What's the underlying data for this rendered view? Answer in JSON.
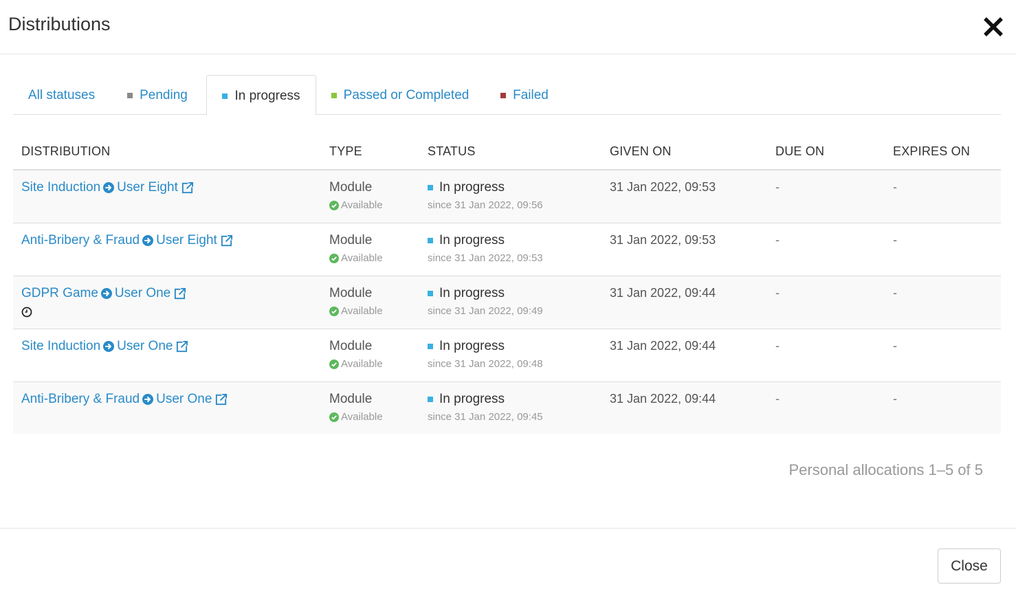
{
  "header": {
    "title": "Distributions"
  },
  "tabs": [
    {
      "label": "All statuses",
      "square_color": null
    },
    {
      "label": "Pending",
      "square_color": "#8a8a8a"
    },
    {
      "label": "In progress",
      "square_color": "#3ab0e2"
    },
    {
      "label": "Passed or Completed",
      "square_color": "#8cc63f"
    },
    {
      "label": "Failed",
      "square_color": "#a33b3b"
    }
  ],
  "active_tab": "In progress",
  "table": {
    "columns": [
      "DISTRIBUTION",
      "TYPE",
      "STATUS",
      "GIVEN ON",
      "DUE ON",
      "EXPIRES ON"
    ],
    "rows": [
      {
        "course": "Site Induction",
        "user": "User Eight",
        "has_clock": false,
        "type": "Module",
        "availability": "Available",
        "status": "In progress",
        "since": "since 31 Jan 2022, 09:56",
        "given_on": "31 Jan 2022, 09:53",
        "due_on": "-",
        "expires_on": "-"
      },
      {
        "course": "Anti-Bribery & Fraud",
        "user": "User Eight",
        "has_clock": false,
        "type": "Module",
        "availability": "Available",
        "status": "In progress",
        "since": "since 31 Jan 2022, 09:53",
        "given_on": "31 Jan 2022, 09:53",
        "due_on": "-",
        "expires_on": "-"
      },
      {
        "course": "GDPR Game",
        "user": "User One",
        "has_clock": true,
        "type": "Module",
        "availability": "Available",
        "status": "In progress",
        "since": "since 31 Jan 2022, 09:49",
        "given_on": "31 Jan 2022, 09:44",
        "due_on": "-",
        "expires_on": "-"
      },
      {
        "course": "Site Induction",
        "user": "User One",
        "has_clock": false,
        "type": "Module",
        "availability": "Available",
        "status": "In progress",
        "since": "since 31 Jan 2022, 09:48",
        "given_on": "31 Jan 2022, 09:44",
        "due_on": "-",
        "expires_on": "-"
      },
      {
        "course": "Anti-Bribery & Fraud",
        "user": "User One",
        "has_clock": false,
        "type": "Module",
        "availability": "Available",
        "status": "In progress",
        "since": "since 31 Jan 2022, 09:45",
        "given_on": "31 Jan 2022, 09:44",
        "due_on": "-",
        "expires_on": "-"
      }
    ]
  },
  "summary": "Personal allocations 1–5 of 5",
  "footer": {
    "close_label": "Close"
  },
  "colors": {
    "link": "#2a8bc8",
    "in_progress": "#3ab0e2",
    "available_check": "#5cb85c"
  },
  "icons": {
    "close": "close-icon",
    "arrow": "arrow-circle-right-icon",
    "external": "external-link-icon",
    "clock": "clock-icon",
    "check": "check-circle-icon"
  }
}
